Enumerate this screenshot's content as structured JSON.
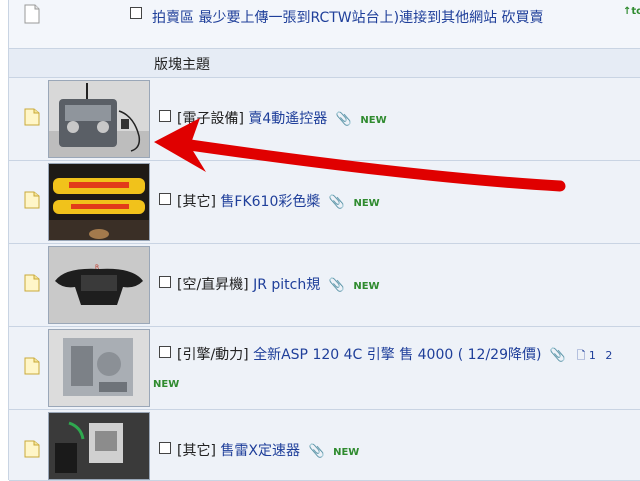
{
  "pinned": {
    "title": "拍賣區 最少要上傳一張到RCTW站台上)連接到其他網站 砍買賣",
    "badge": "to"
  },
  "section": {
    "label": "版塊主題"
  },
  "threads": [
    {
      "category": "[電子設備]",
      "title": "賣4動遙控器",
      "new": "NEW",
      "clip": "📎"
    },
    {
      "category": "[其它]",
      "title": "售FK610彩色槳",
      "new": "NEW",
      "clip": "📎"
    },
    {
      "category": "[空/直昇機]",
      "title": "JR pitch規",
      "new": "NEW",
      "clip": "📎"
    },
    {
      "category": "[引擎/動力]",
      "title": "全新ASP 120 4C 引擎 售 4000 ( 12/29降價)",
      "new": "NEW",
      "clip": "📎",
      "pages": [
        "1",
        "2"
      ]
    },
    {
      "category": "[其它]",
      "title": "售雷X定速器",
      "new": "NEW",
      "clip": "📎"
    }
  ],
  "colors": {
    "link": "#1f3f9a",
    "new": "#2f8b2f",
    "arrow": "#e00000",
    "row_bg": "#eef2f8"
  }
}
